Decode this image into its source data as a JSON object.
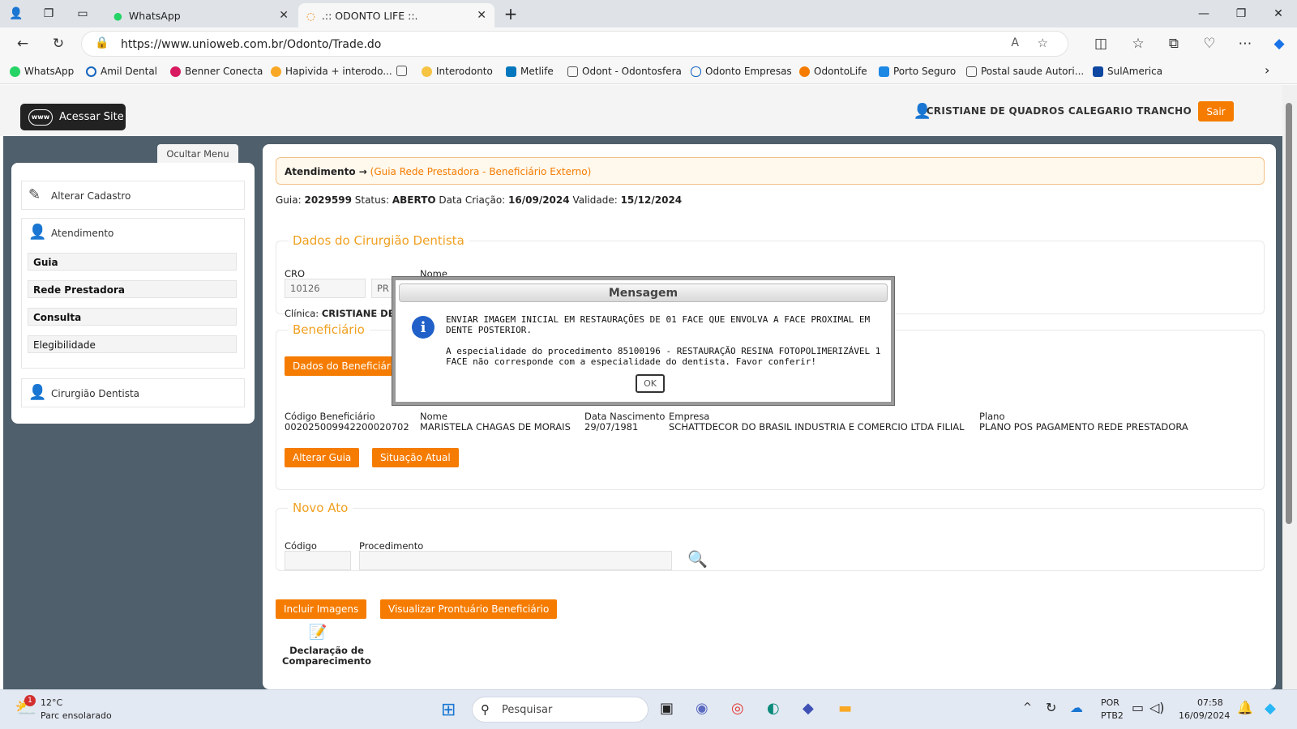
{
  "browser": {
    "tabs": [
      {
        "label": "WhatsApp"
      },
      {
        "label": ".:: ODONTO LIFE ::."
      }
    ],
    "url": "https://www.unioweb.com.br/Odonto/Trade.do",
    "bookmarks": [
      "WhatsApp",
      "Amil Dental",
      "Benner Conecta",
      "Hapivida + interodo...",
      "Interodonto",
      "Metlife",
      "Odont - Odontosfera",
      "Odonto Empresas",
      "OdontoLife",
      "Porto Seguro",
      "Postal saude Autori...",
      "SulAmerica"
    ]
  },
  "header": {
    "acessar_site": "Acessar Site",
    "www": "www",
    "user_name": "CRISTIANE DE QUADROS CALEGARIO TRANCHO",
    "sair": "Sair"
  },
  "sidebar": {
    "ocultar_menu": "Ocultar Menu",
    "alterar_cadastro": "Alterar Cadastro",
    "atendimento": "Atendimento",
    "items": [
      "Guia",
      "Rede Prestadora",
      "Consulta",
      "Elegibilidade"
    ],
    "cirurgiao": "Cirurgião Dentista"
  },
  "main": {
    "breadcrumb_bold": "Atendimento →",
    "breadcrumb_sub": "(Guia Rede Prestadora - Beneficiário Externo)",
    "info": {
      "guia_label": "Guia:",
      "guia": "2029599",
      "status_label": "Status:",
      "status": "ABERTO",
      "criacao_label": "Data Criação:",
      "criacao": "16/09/2024",
      "validade_label": "Validade:",
      "validade": "15/12/2024"
    },
    "dentista": {
      "legend": "Dados do Cirurgião Dentista",
      "cro_label": "CRO",
      "cro": "10126",
      "uf": "PR",
      "nome_label": "Nome",
      "clinica_label": "Clínica:",
      "clinica": "CRISTIANE DE"
    },
    "beneficiario": {
      "legend": "Beneficiário",
      "dados_button": "Dados do Beneficiário",
      "codigo_label": "Código Beneficiário",
      "codigo": "002025009942200020702",
      "nome_label": "Nome",
      "nome": "MARISTELA CHAGAS DE MORAIS",
      "nasc_label": "Data Nascimento",
      "nasc": "29/07/1981",
      "empresa_label": "Empresa",
      "empresa": "SCHATTDECOR DO BRASIL INDUSTRIA E COMERCIO LTDA FILIAL",
      "plano_label": "Plano",
      "plano": "PLANO POS PAGAMENTO REDE PRESTADORA",
      "alterar_guia": "Alterar Guia",
      "situacao_atual": "Situação Atual"
    },
    "novo_ato": {
      "legend": "Novo Ato",
      "codigo_label": "Código",
      "procedimento_label": "Procedimento"
    },
    "incluir_imagens": "Incluir Imagens",
    "visualizar_prontuario": "Visualizar Prontuário Beneficiário",
    "declaracao_1": "Declaração de",
    "declaracao_2": "Comparecimento"
  },
  "modal": {
    "title": "Mensagem",
    "line1": "ENVIAR IMAGEM INICIAL EM RESTAURAÇÕES DE 01 FACE QUE ENVOLVA A FACE PROXIMAL EM DENTE POSTERIOR.",
    "line2": "A especialidade do procedimento 85100196 - RESTAURAÇÃO RESINA FOTOPOLIMERIZÁVEL 1 FACE não corresponde com a especialidade do dentista. Favor conferir!",
    "ok": "OK"
  },
  "taskbar": {
    "temp": "12°C",
    "weather": "Parc ensolarado",
    "badge": "1",
    "search": "Pesquisar",
    "lang1": "POR",
    "lang2": "PTB2",
    "time": "07:58",
    "date": "16/09/2024"
  }
}
